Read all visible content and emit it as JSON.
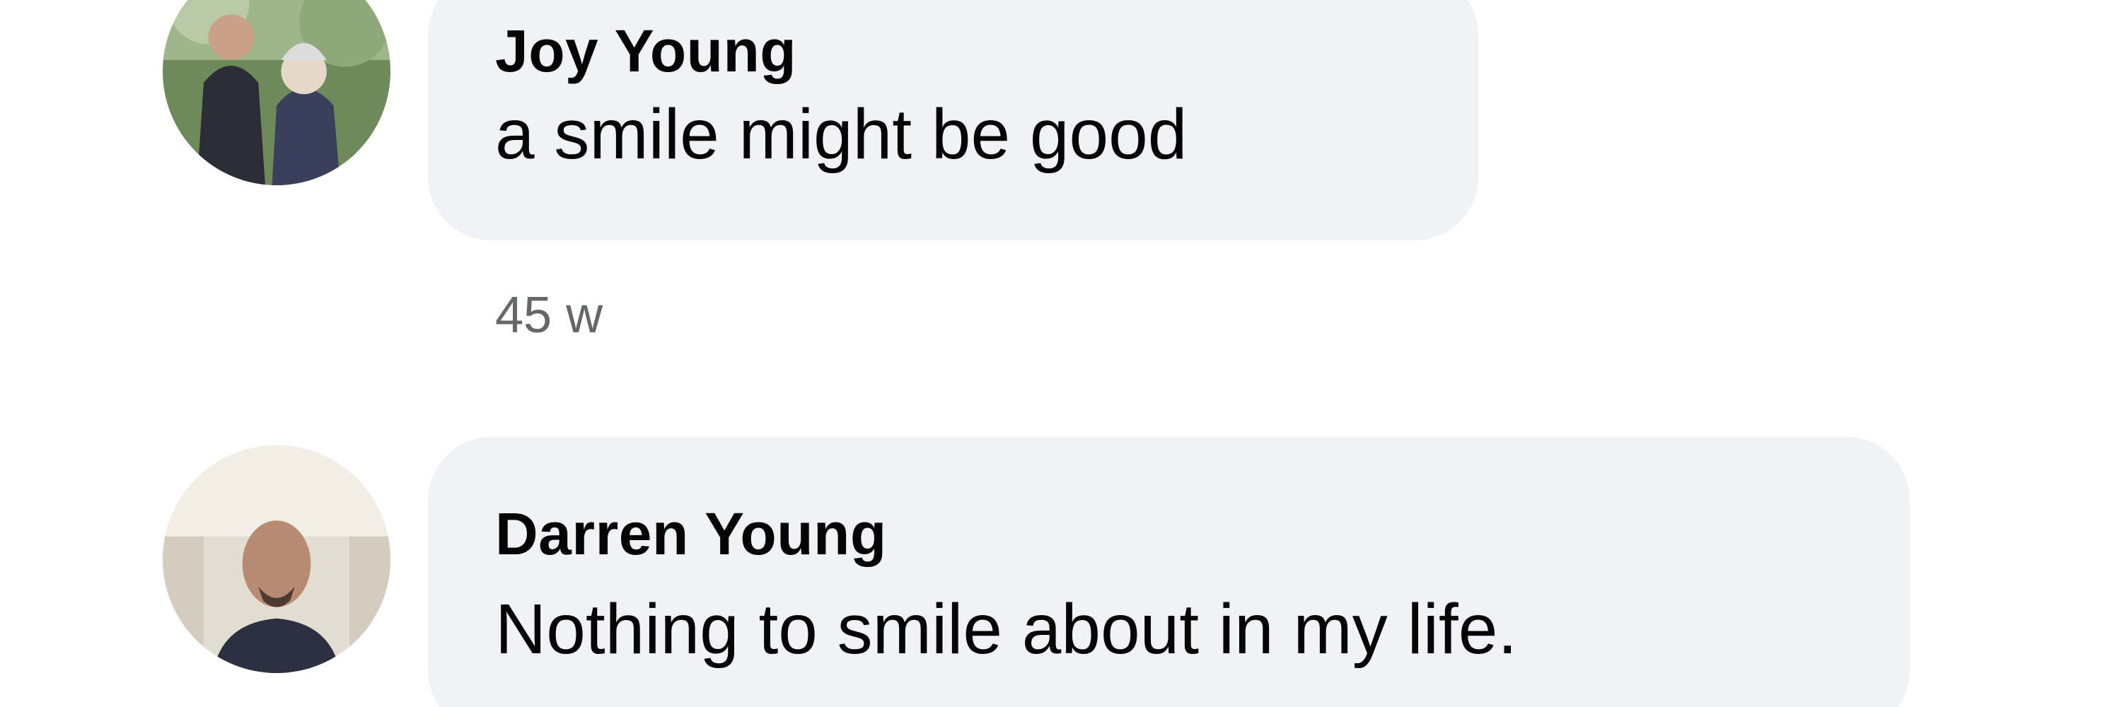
{
  "comments": [
    {
      "author": "Joy Young",
      "message": "a smile might be good",
      "timestamp": "45 w",
      "avatar_icon": "profile-photo-icon"
    },
    {
      "author": "Darren Young",
      "message": "Nothing to smile about in my life.",
      "avatar_icon": "profile-photo-icon"
    }
  ],
  "colors": {
    "bubble_bg": "#f0f2f5",
    "text": "#050505",
    "secondary_text": "#65676b"
  }
}
